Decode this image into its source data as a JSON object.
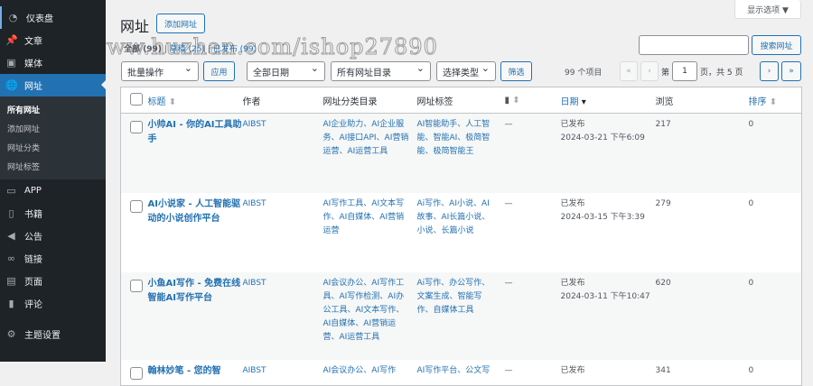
{
  "sidebar": {
    "items": [
      {
        "label": "仪表盘",
        "icon": "dashboard-icon"
      },
      {
        "label": "文章",
        "icon": "pin-icon"
      },
      {
        "label": "媒体",
        "icon": "media-icon"
      },
      {
        "label": "网址",
        "icon": "globe-icon"
      }
    ],
    "submenu": [
      "所有网址",
      "添加网址",
      "网址分类",
      "网址标签"
    ],
    "items2": [
      {
        "label": "APP",
        "icon": "archive-icon"
      },
      {
        "label": "书籍",
        "icon": "book-icon"
      },
      {
        "label": "公告",
        "icon": "megaphone-icon"
      },
      {
        "label": "链接",
        "icon": "link-icon"
      },
      {
        "label": "页面",
        "icon": "page-icon"
      },
      {
        "label": "评论",
        "icon": "comment-icon"
      },
      {
        "label": "主题设置",
        "icon": "gear-icon"
      }
    ]
  },
  "header": {
    "title": "网址",
    "add_label": "添加网址",
    "screen_options": "显示选项 ▼"
  },
  "views": {
    "all": "全部 (99)",
    "draft": "草稿 (25)",
    "published": "已发布 (99)"
  },
  "search": {
    "value": "",
    "button": "搜索网址"
  },
  "filters": {
    "bulk": "批量操作",
    "apply": "应用",
    "date": "全部日期",
    "category": "所有网址目录",
    "type": "选择类型",
    "filter": "筛选"
  },
  "pagination": {
    "count": "99 个项目",
    "first": "«",
    "prev": "‹",
    "page_prefix": "第",
    "page": "1",
    "page_suffix": "页，共 5 页",
    "next": "›",
    "last": "»"
  },
  "table": {
    "headers": [
      "标题",
      "作者",
      "网址分类目录",
      "网址标签",
      "日期",
      "浏览",
      "排序"
    ],
    "rows": [
      {
        "title": "小帅AI - 你的AI工具助手",
        "author": "AIBST",
        "cats": "AI企业助力、AI企业服务、AI接口API、AI营销运营、AI运营工具",
        "tags": "AI智能助手、人工智能、智能AI、极简智能、极简智能王",
        "comments": "—",
        "status": "已发布",
        "date": "2024-03-21 下午6:09",
        "views": "217",
        "order": "0"
      },
      {
        "title": "AI小说家 - 人工智能驱动的小说创作平台",
        "author": "AIBST",
        "cats": "AI写作工具、AI文本写作、AI自媒体、AI营销运营",
        "tags": "Ai写作、AI小说、AI故事、AI长篇小说、小说、长篇小说",
        "comments": "—",
        "status": "已发布",
        "date": "2024-03-15 下午3:39",
        "views": "279",
        "order": "0"
      },
      {
        "title": "小鱼AI写作 - 免费在线智能AI写作平台",
        "author": "AIBST",
        "cats": "AI会议办公、AI写作工具、AI写作检测、AI办公工具、AI文本写作、AI自媒体、AI营销运营、AI运营工具",
        "tags": "Ai写作、办公写作、文案生成、智能写作、自媒体工具",
        "comments": "—",
        "status": "已发布",
        "date": "2024-03-11 下午10:47",
        "views": "620",
        "order": "0"
      },
      {
        "title": "翰林妙笔 - 您的智",
        "author": "AIBST",
        "cats": "AI会议办公、AI写作",
        "tags": "AI写作平台、公文写",
        "comments": "—",
        "status": "已发布",
        "date": "",
        "views": "341",
        "order": "0"
      }
    ]
  },
  "watermark": "https://www.huzhan.com/ishop27890"
}
